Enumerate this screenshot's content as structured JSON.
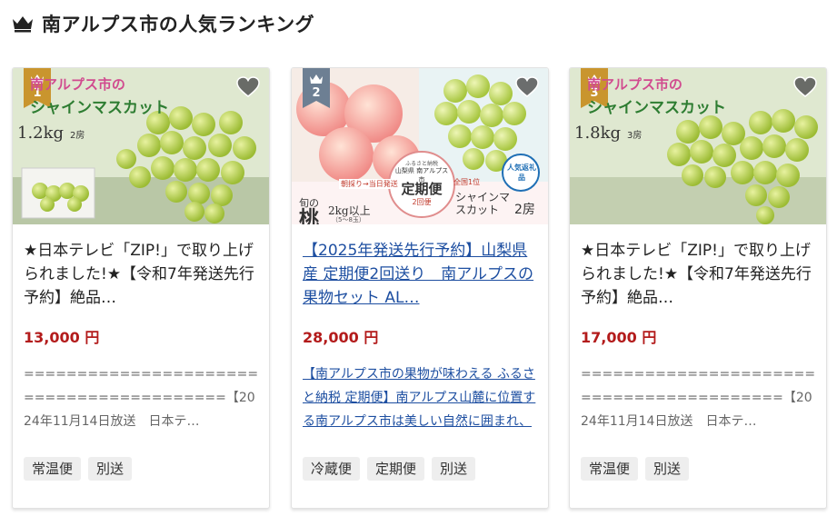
{
  "page": {
    "title": "南アルプス市の人気ランキング",
    "title_icon": "crown-icon"
  },
  "colors": {
    "price": "#b31b1b",
    "link": "#1e4fa1",
    "gold_badge": "#c9952e",
    "silver_badge": "#6d7f93",
    "tag_bg": "#eeeeee"
  },
  "cards": [
    {
      "rank": "1",
      "badge_color": "#c9952e",
      "image_text": {
        "line1": "南アルプス市の",
        "line2": "シャインマスカット",
        "weight": "1.2kg",
        "count": "2房"
      },
      "favorite_icon": "heart-icon",
      "name": "★日本テレビ「ZIP!」で取り上げられました!★【令和7年発送先行予約】絶品…",
      "price": "13,000 円",
      "description": "=========================================【2024年11月14日放送　日本テ…",
      "tags": [
        "常温便",
        "別送"
      ]
    },
    {
      "rank": "2",
      "badge_color": "#6d7f93",
      "image_text": {
        "peach": "桃",
        "peach_weight": "2kg以上",
        "peach_range": "（5～8玉）",
        "plan_top": "ふるさと納税",
        "plan_area": "山梨県 南アルプス市",
        "plan": "定期便",
        "plan_times": "2回便",
        "grape": "シャインマスカット",
        "grape_count": "2房",
        "badge": "人気返礼品",
        "rank_label": "全国1位",
        "ship": "朝採り→当日発送",
        "season": "旬の"
      },
      "favorite_icon": "heart-icon",
      "name": "【2025年発送先行予約】山梨県産 定期便2回送り　南アルプスの果物セット AL…",
      "price": "28,000 円",
      "description": "【南アルプス市の果物が味わえる ふるさと納税 定期便】南アルプス山麓に位置する南アルプス市は美しい自然に囲まれ、多種多様な果物…",
      "tags": [
        "冷蔵便",
        "定期便",
        "別送"
      ]
    },
    {
      "rank": "3",
      "badge_color": "#c9952e",
      "image_text": {
        "line1": "南アルプス市の",
        "line2": "シャインマスカット",
        "weight": "1.8kg",
        "count": "3房"
      },
      "favorite_icon": "heart-icon",
      "name": "★日本テレビ「ZIP!」で取り上げられました!★【令和7年発送先行予約】絶品…",
      "price": "17,000 円",
      "description": "=========================================【2024年11月14日放送　日本テ…",
      "tags": [
        "常温便",
        "別送"
      ]
    }
  ]
}
